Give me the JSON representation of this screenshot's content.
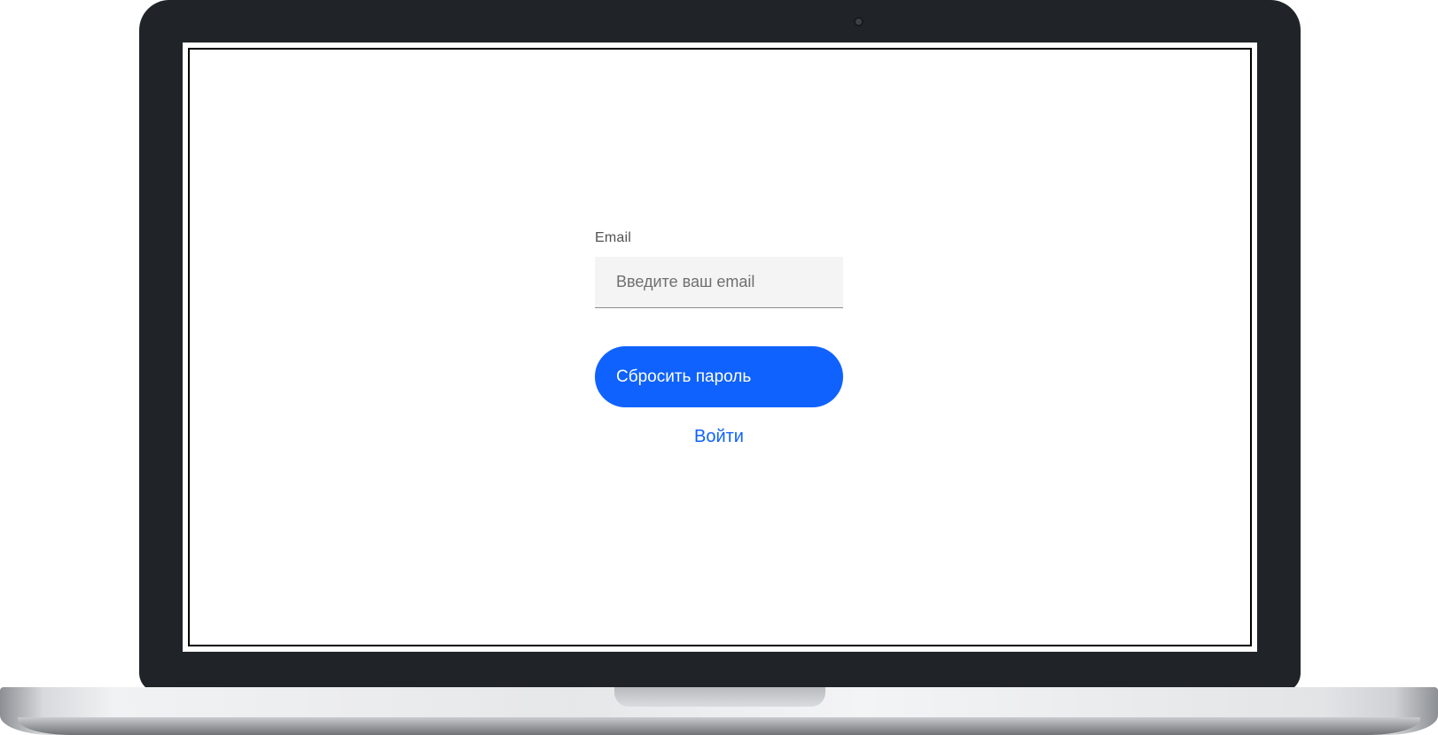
{
  "form": {
    "email_label": "Email",
    "email_value": "",
    "email_placeholder": "Введите ваш email",
    "submit_label": "Сбросить пароль",
    "login_link_label": "Войти"
  },
  "colors": {
    "accent": "#0f62fe",
    "input_background": "#f4f4f4",
    "label_text": "#525252",
    "laptop_bezel": "#202428"
  },
  "icons": {
    "camera": "webcam-icon"
  }
}
